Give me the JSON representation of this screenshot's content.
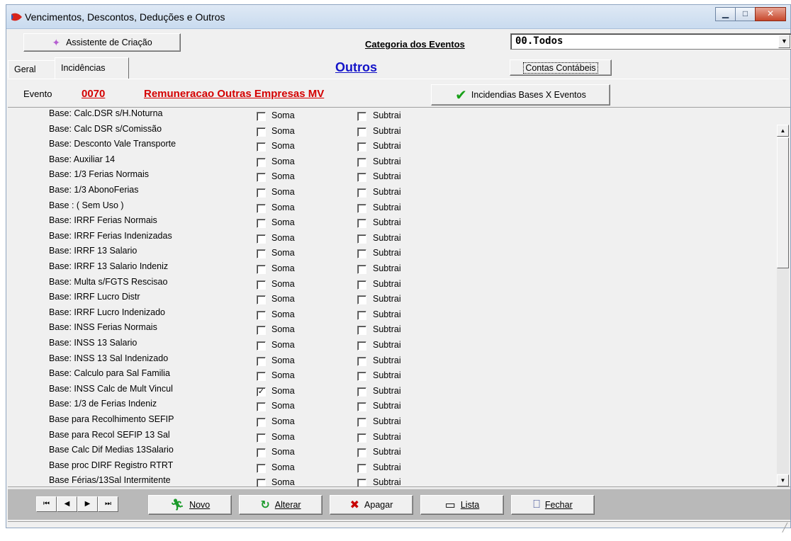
{
  "window": {
    "title": "Vencimentos, Descontos, Deduções e Outros",
    "caption_buttons": [
      "minimize",
      "restore",
      "close"
    ]
  },
  "toolbar": {
    "assistant_label": "Assistente de Criação",
    "category_label": "Categoria dos Eventos",
    "category_value": "00.Todos"
  },
  "tabs": [
    {
      "label": "Geral",
      "active": false
    },
    {
      "label": "Incidências",
      "active": true
    }
  ],
  "section_title": "Outros",
  "contas_button": "Contas Contábeis",
  "evento": {
    "label": "Evento",
    "code": "0070",
    "name": "Remuneracao Outras Empresas MV",
    "incidencias_button": "Incidendias Bases X Eventos"
  },
  "options": {
    "soma_label": "Soma",
    "subtrai_label": "Subtrai"
  },
  "bases": [
    {
      "label": "Base: Calc.DSR s/H.Noturna",
      "soma": false,
      "subtrai": false
    },
    {
      "label": "Base: Calc DSR s/Comissão",
      "soma": false,
      "subtrai": false
    },
    {
      "label": "Base: Desconto Vale Transporte",
      "soma": false,
      "subtrai": false
    },
    {
      "label": "Base: Auxiliar 14",
      "soma": false,
      "subtrai": false
    },
    {
      "label": "Base: 1/3 Ferias Normais",
      "soma": false,
      "subtrai": false
    },
    {
      "label": "Base: 1/3 AbonoFerias",
      "soma": false,
      "subtrai": false
    },
    {
      "label": "Base : ( Sem Uso )",
      "soma": false,
      "subtrai": false
    },
    {
      "label": "Base: IRRF Ferias Normais",
      "soma": false,
      "subtrai": false
    },
    {
      "label": "Base: IRRF Ferias Indenizadas",
      "soma": false,
      "subtrai": false
    },
    {
      "label": "Base: IRRF 13 Salario",
      "soma": false,
      "subtrai": false
    },
    {
      "label": "Base: IRRF 13 Salario Indeniz",
      "soma": false,
      "subtrai": false
    },
    {
      "label": "Base: Multa s/FGTS Rescisao",
      "soma": false,
      "subtrai": false
    },
    {
      "label": "Base: IRRF Lucro Distr",
      "soma": false,
      "subtrai": false
    },
    {
      "label": "Base: IRRF Lucro Indenizado",
      "soma": false,
      "subtrai": false
    },
    {
      "label": "Base: INSS Ferias Normais",
      "soma": false,
      "subtrai": false
    },
    {
      "label": "Base: INSS 13 Salario",
      "soma": false,
      "subtrai": false
    },
    {
      "label": "Base: INSS 13 Sal Indenizado",
      "soma": false,
      "subtrai": false
    },
    {
      "label": "Base: Calculo para Sal Familia",
      "soma": false,
      "subtrai": false
    },
    {
      "label": "Base: INSS Calc de Mult Vincul",
      "soma": true,
      "subtrai": false
    },
    {
      "label": "Base: 1/3 de Ferias Indeniz",
      "soma": false,
      "subtrai": false
    },
    {
      "label": "Base para Recolhimento SEFIP",
      "soma": false,
      "subtrai": false
    },
    {
      "label": "Base para Recol SEFIP 13 Sal",
      "soma": false,
      "subtrai": false
    },
    {
      "label": "Base Calc Dif Medias 13Salario",
      "soma": false,
      "subtrai": false
    },
    {
      "label": "Base proc DIRF Registro RTRT",
      "soma": false,
      "subtrai": false
    },
    {
      "label": "Base Férias/13Sal Intermitente",
      "soma": false,
      "subtrai": false
    }
  ],
  "navigation": [
    "first",
    "previous",
    "next",
    "last"
  ],
  "actions": {
    "novo": "Novo",
    "alterar": "Alterar",
    "apagar": "Apagar",
    "lista": "Lista",
    "fechar": "Fechar"
  }
}
